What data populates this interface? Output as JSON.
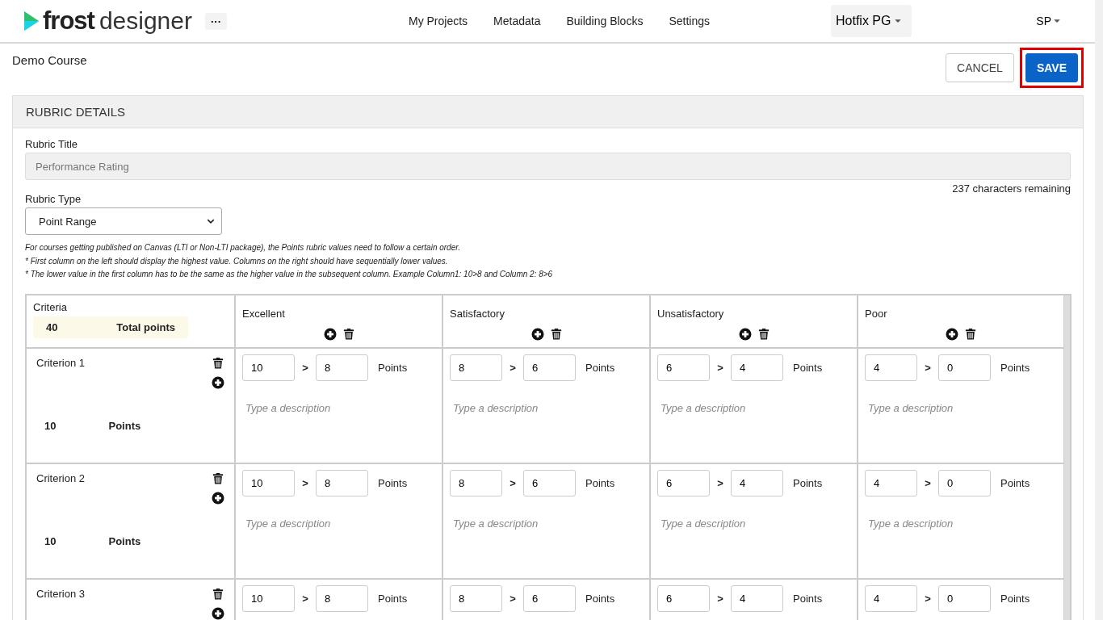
{
  "header": {
    "logo_bold": "frost",
    "logo_light": "designer",
    "more": "···",
    "nav": [
      {
        "label": "My Projects"
      },
      {
        "label": "Metadata"
      },
      {
        "label": "Building Blocks"
      },
      {
        "label": "Settings"
      }
    ],
    "project": "Hotfix PG",
    "user": "SP"
  },
  "course": "Demo Course",
  "actions": [
    {
      "kind": "secondary",
      "label": "CANCEL",
      "highlighted": false
    },
    {
      "kind": "primary",
      "label": "SAVE",
      "highlighted": true
    }
  ],
  "panel": {
    "title": "RUBRIC DETAILS",
    "title_field": {
      "label": "Rubric Title",
      "value": "Performance Rating",
      "disabled": true,
      "remaining": "237 characters remaining"
    },
    "type_field": {
      "label": "Rubric Type",
      "value": "Point Range"
    },
    "notes": [
      "For courses getting published on Canvas (LTI or Non-LTI package), the Points rubric values need to follow a certain order.",
      "* First column on the left should display the highest value. Columns on the right should have sequentially lower values.",
      "* The lower value in the first column has to be the same as the higher value in the subsequent column. Example Column1: 10>8 and Column 2: 8>6"
    ],
    "table": {
      "criteria_heading": "Criteria",
      "total": "40",
      "total_label": "Total points",
      "columns": [
        {
          "label": "Excellent"
        },
        {
          "label": "Satisfactory"
        },
        {
          "label": "Unsatisfactory"
        },
        {
          "label": "Poor"
        }
      ],
      "rows": [
        {
          "name": "Criterion 1",
          "points": "10",
          "points_label": "Points",
          "cells": [
            {
              "high": "10",
              "sep": ">",
              "low": "8",
              "unit": "Points",
              "placeholder": "Type a description"
            },
            {
              "high": "8",
              "sep": ">",
              "low": "6",
              "unit": "Points",
              "placeholder": "Type a description"
            },
            {
              "high": "6",
              "sep": ">",
              "low": "4",
              "unit": "Points",
              "placeholder": "Type a description"
            },
            {
              "high": "4",
              "sep": ">",
              "low": "0",
              "unit": "Points",
              "placeholder": "Type a description"
            }
          ]
        },
        {
          "name": "Criterion 2",
          "points": "10",
          "points_label": "Points",
          "cells": [
            {
              "high": "10",
              "sep": ">",
              "low": "8",
              "unit": "Points",
              "placeholder": "Type a description"
            },
            {
              "high": "8",
              "sep": ">",
              "low": "6",
              "unit": "Points",
              "placeholder": "Type a description"
            },
            {
              "high": "6",
              "sep": ">",
              "low": "4",
              "unit": "Points",
              "placeholder": "Type a description"
            },
            {
              "high": "4",
              "sep": ">",
              "low": "0",
              "unit": "Points",
              "placeholder": "Type a description"
            }
          ]
        },
        {
          "name": "Criterion 3",
          "cells": [
            {
              "high": "10",
              "sep": ">",
              "low": "8",
              "unit": "Points"
            },
            {
              "high": "8",
              "sep": ">",
              "low": "6",
              "unit": "Points"
            },
            {
              "high": "6",
              "sep": ">",
              "low": "4",
              "unit": "Points"
            },
            {
              "high": "4",
              "sep": ">",
              "low": "0",
              "unit": "Points"
            }
          ]
        }
      ]
    }
  }
}
